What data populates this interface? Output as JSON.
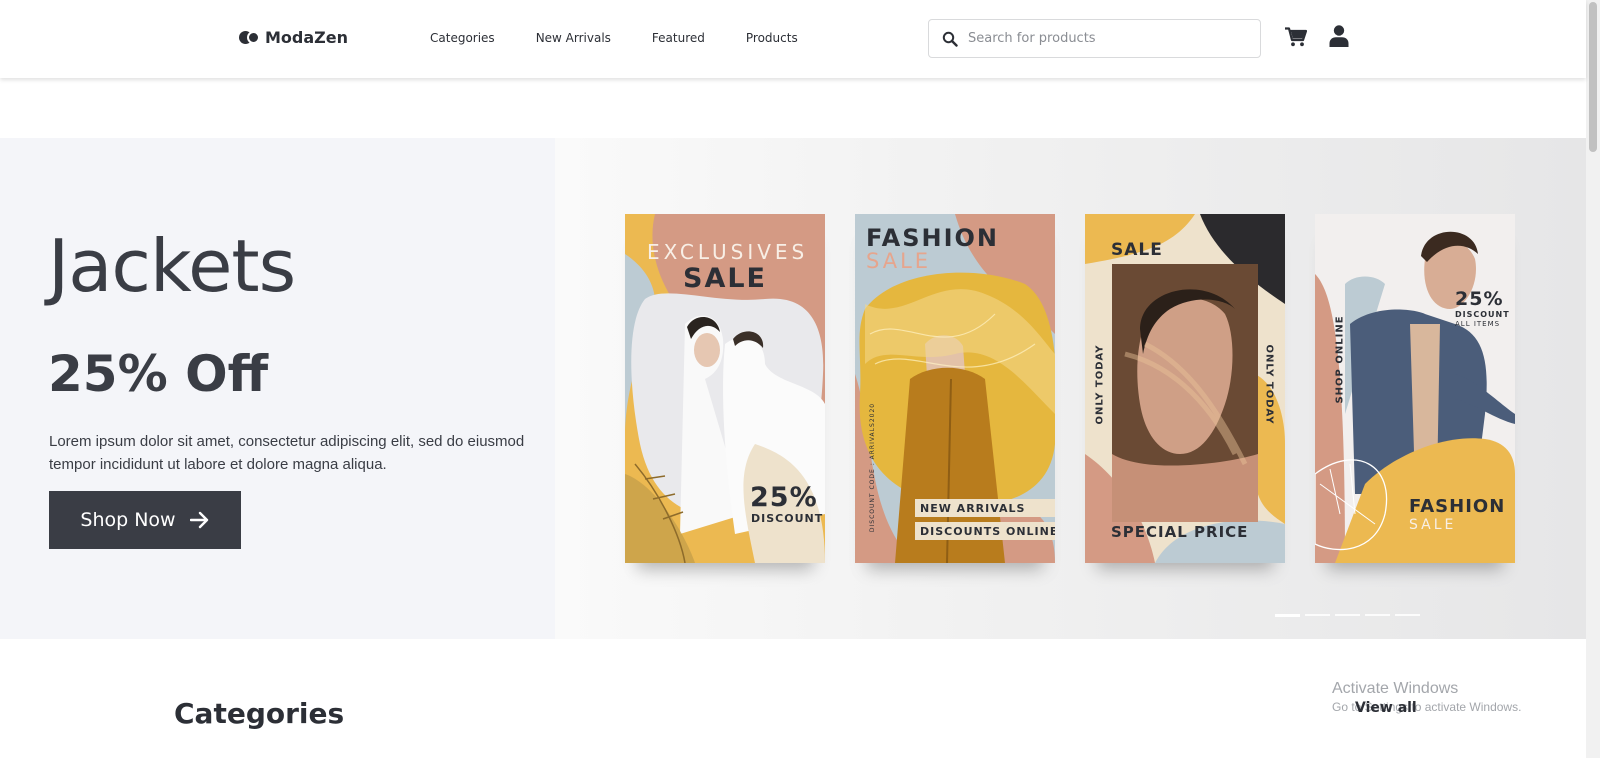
{
  "brand": {
    "name": "ModaZen"
  },
  "nav": {
    "items": [
      "Categories",
      "New Arrivals",
      "Featured",
      "Products"
    ]
  },
  "search": {
    "placeholder": "Search for products",
    "value": ""
  },
  "header_icons": [
    "search-icon",
    "cart-icon",
    "user-icon"
  ],
  "hero": {
    "title": "Jackets",
    "offer": "25% Off",
    "description": "Lorem ipsum dolor sit amet, consectetur adipiscing elit, sed do eiusmod tempor incididunt ut labore et dolore magna aliqua.",
    "cta_label": "Shop Now",
    "cta_icon": "arrow-right-icon",
    "slide_count": 5,
    "active_slide": 1
  },
  "posters": [
    {
      "line1": "EXCLUSIVES",
      "line2": "SALE",
      "badge": "25%",
      "badge_sub": "DISCOUNT"
    },
    {
      "line1": "FASHION",
      "line2": "SALE",
      "tag1": "NEW ARRIVALS",
      "tag2": "DISCOUNTS ONLINE",
      "code": "DISCOUNT CODE : ARRIVALS2020"
    },
    {
      "line1": "SALE",
      "side_left": "ONLY TODAY",
      "side_right": "ONLY TODAY",
      "footer": "SPECIAL PRICE"
    },
    {
      "badge": "25%",
      "badge_sub": "DISCOUNT",
      "badge_sub2": "ALL ITEMS",
      "side": "SHOP ONLINE",
      "line1": "FASHION",
      "line2": "SALE"
    }
  ],
  "categories": {
    "title": "Categories",
    "view_all": "View all"
  },
  "system_overlay": {
    "line1": "Activate Windows",
    "line2": "Go to Settings to activate Windows."
  },
  "colors": {
    "dark": "#3a3d45",
    "hero_left_bg": "#f4f5f9",
    "mustard": "#ecb951",
    "terracotta": "#d49a84",
    "dusty_blue": "#bccbd3",
    "cream": "#eee2cc"
  }
}
